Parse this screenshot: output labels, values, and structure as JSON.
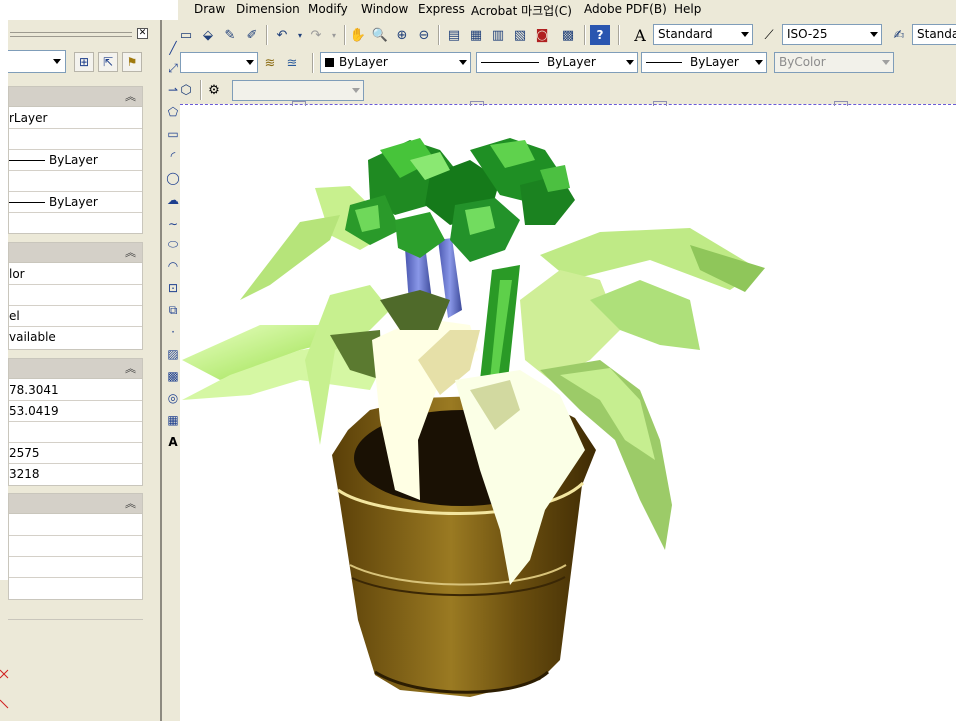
{
  "menu": {
    "items": [
      "Draw",
      "Dimension",
      "Modify",
      "Window",
      "Express",
      "Acrobat 마크업(C)",
      "Adobe PDF(B)",
      "Help"
    ]
  },
  "styles_toolbar": {
    "text_style": "Standard",
    "dim_style": "ISO-25",
    "table_style": "Standa"
  },
  "properties_toolbar": {
    "color": "ByLayer",
    "linetype": "ByLayer",
    "lineweight": "ByLayer",
    "plotstyle": "ByColor"
  },
  "palette": {
    "close_glyph": "✕",
    "general_rows": [
      "rLayer",
      "",
      "ByLayer",
      "",
      "ByLayer"
    ],
    "plot_rows": [
      "lor",
      "",
      "el",
      "vailable"
    ],
    "view_rows": [
      "78.3041",
      "53.0419",
      "",
      "2575",
      "3218"
    ],
    "misc_rows": [
      "",
      "",
      ""
    ]
  },
  "colors": {
    "ui_face": "#ece9d8",
    "canvas": "#ffffff",
    "pot": "#7a5a12",
    "leaf_light": "#c9f58a",
    "leaf_dark": "#2f8f1e",
    "stem_blue": "#6878cc"
  }
}
